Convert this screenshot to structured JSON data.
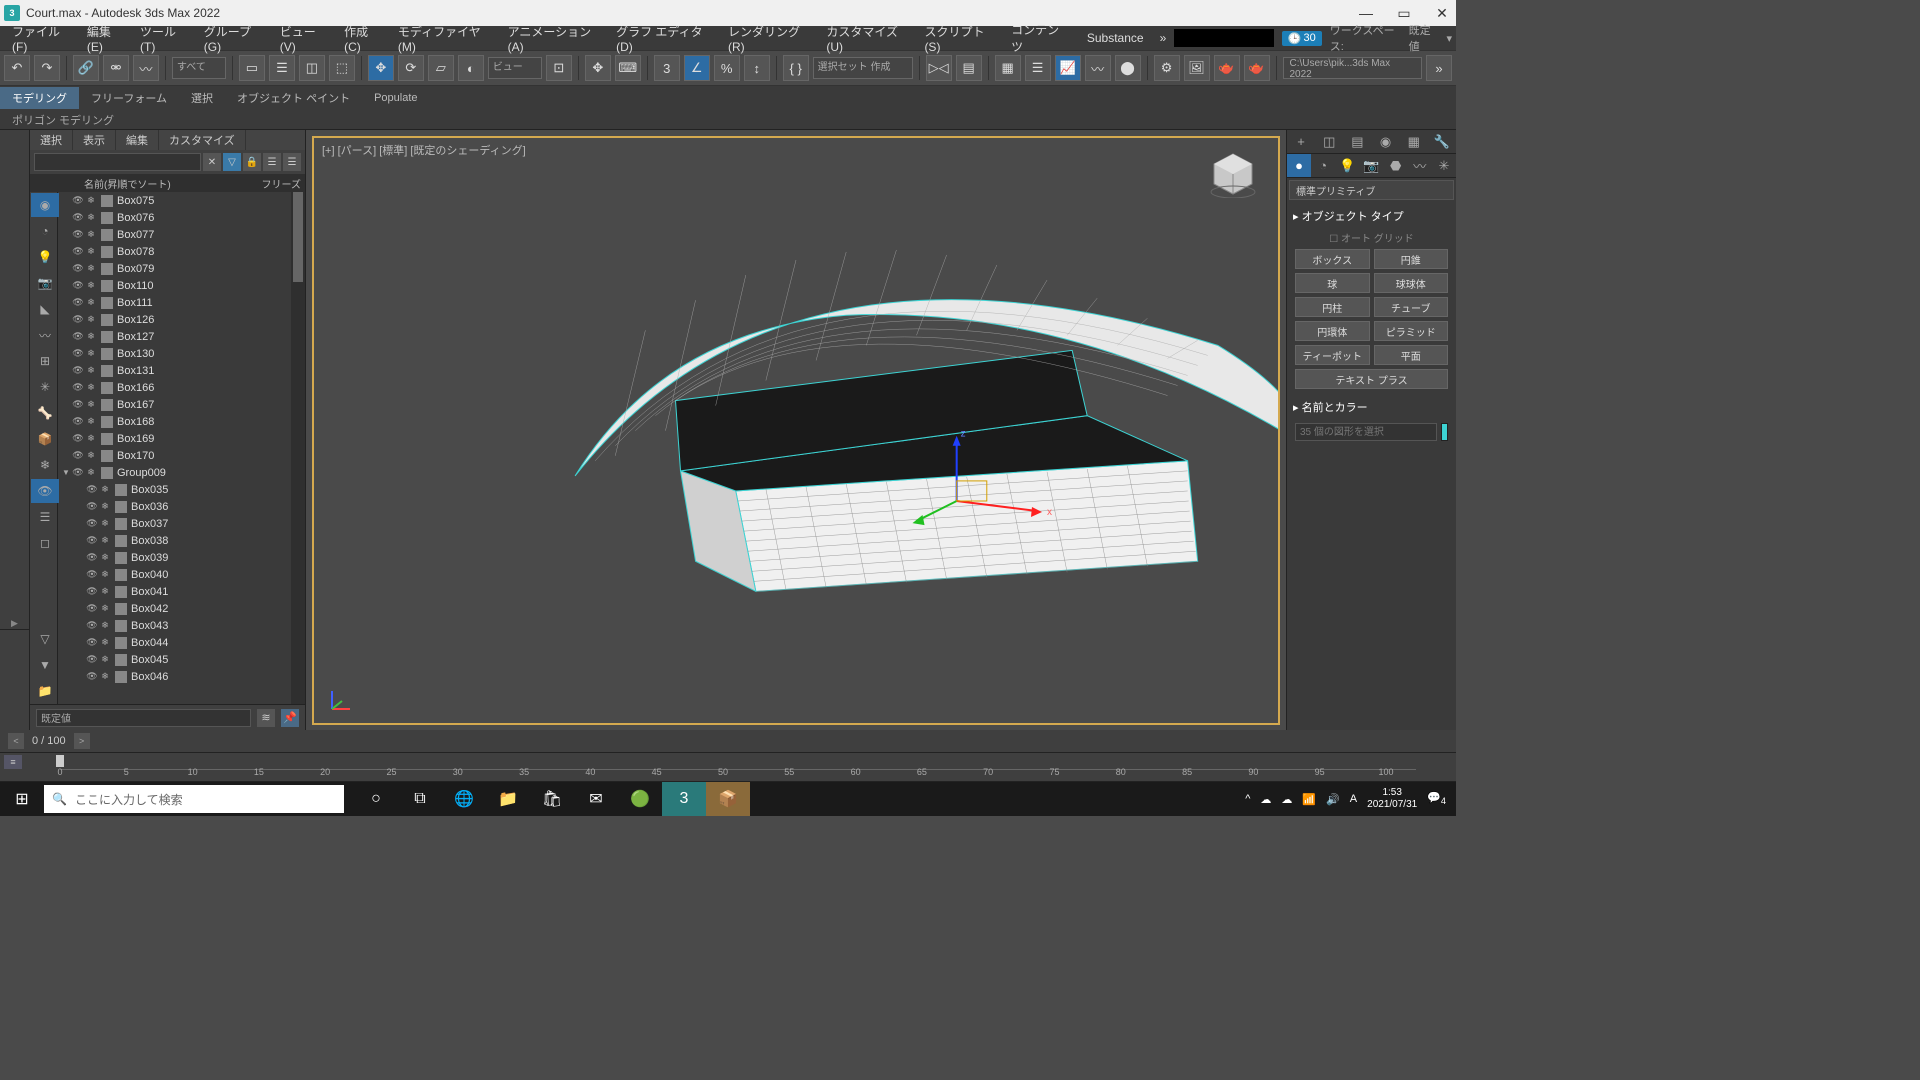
{
  "titlebar": {
    "app_icon_text": "3",
    "title": "Court.max - Autodesk 3ds Max 2022"
  },
  "menu": [
    "ファイル(F)",
    "編集(E)",
    "ツール(T)",
    "グループ(G)",
    "ビュー(V)",
    "作成(C)",
    "モディファイヤ(M)",
    "アニメーション(A)",
    "グラフ エディタ(D)",
    "レンダリング(R)",
    "カスタマイズ(U)",
    "スクリプト(S)",
    "コンテンツ",
    "Substance"
  ],
  "timer": "30",
  "workspace_label": "ワークスペース:",
  "workspace_value": "既定値",
  "toolbar1": {
    "filter": "すべて",
    "view_label": "ビュー",
    "selset": "選択セット 作成",
    "path": "C:\\Users\\pik...3ds Max 2022"
  },
  "ribbon_tabs": [
    "モデリング",
    "フリーフォーム",
    "選択",
    "オブジェクト ペイント",
    "Populate"
  ],
  "ribbon2": "ポリゴン モデリング",
  "scene": {
    "tabs": [
      "選択",
      "表示",
      "編集",
      "カスタマイズ"
    ],
    "sort": "名前(昇順でソート)",
    "freeze": "フリーズ",
    "default_set": "既定値",
    "items": [
      "Box075",
      "Box076",
      "Box077",
      "Box078",
      "Box079",
      "Box110",
      "Box111",
      "Box126",
      "Box127",
      "Box130",
      "Box131",
      "Box166",
      "Box167",
      "Box168",
      "Box169",
      "Box170"
    ],
    "group": "Group009",
    "children": [
      "Box035",
      "Box036",
      "Box037",
      "Box038",
      "Box039",
      "Box040",
      "Box041",
      "Box042",
      "Box043",
      "Box044",
      "Box045",
      "Box046"
    ]
  },
  "viewport_label": "[+]  [パース]  [標準]  [既定のシェーディング]",
  "right": {
    "prim_set": "標準プリミティブ",
    "sect1": "▸ オブジェクト タイプ",
    "autogrid": "オート グリッド",
    "buttons": [
      "ボックス",
      "円錐",
      "球",
      "球球体",
      "円柱",
      "チューブ",
      "円環体",
      "ピラミッド",
      "ティーポット",
      "平面"
    ],
    "textplus": "テキスト プラス",
    "sect2": "▸ 名前とカラー",
    "name_placeholder": "35 個の図形を選択"
  },
  "timeline": {
    "cur": "0 / 100",
    "ticks": [
      0,
      5,
      10,
      15,
      20,
      25,
      30,
      35,
      40,
      45,
      50,
      55,
      60,
      65,
      70,
      75,
      80,
      85,
      90,
      95,
      100
    ]
  },
  "taskbar": {
    "search_placeholder": "ここに入力して検索",
    "time": "1:53",
    "date": "2021/07/31",
    "notif": "4"
  }
}
